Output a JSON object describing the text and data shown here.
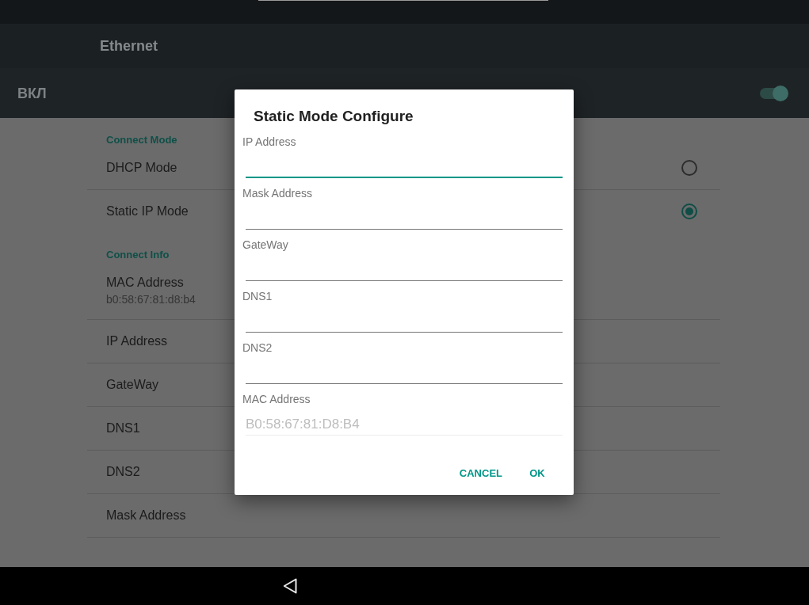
{
  "action_bar": {
    "title": "Ethernet"
  },
  "master_switch": {
    "label": "ВКЛ",
    "on": true
  },
  "settings": {
    "sections": [
      {
        "header": "Connect Mode",
        "items": [
          {
            "kind": "radio",
            "title": "DHCP Mode",
            "selected": false
          },
          {
            "kind": "radio",
            "title": "Static IP Mode",
            "selected": true
          }
        ]
      },
      {
        "header": "Connect Info",
        "items": [
          {
            "kind": "info",
            "title": "MAC Address",
            "summary": "b0:58:67:81:d8:b4"
          },
          {
            "kind": "info",
            "title": "IP Address"
          },
          {
            "kind": "info",
            "title": "GateWay"
          },
          {
            "kind": "info",
            "title": "DNS1"
          },
          {
            "kind": "info",
            "title": "DNS2"
          },
          {
            "kind": "info",
            "title": "Mask Address"
          }
        ]
      }
    ]
  },
  "dialog": {
    "title": "Static Mode Configure",
    "fields": [
      {
        "label": "IP Address",
        "focused": true,
        "disabled": false
      },
      {
        "label": "Mask Address",
        "focused": false,
        "disabled": false
      },
      {
        "label": "GateWay",
        "focused": false,
        "disabled": false
      },
      {
        "label": "DNS1",
        "focused": false,
        "disabled": false
      },
      {
        "label": "DNS2",
        "focused": false,
        "disabled": false
      },
      {
        "label": "MAC Address",
        "value": "B0:58:67:81:D8:B4",
        "focused": false,
        "disabled": true
      }
    ],
    "buttons": [
      {
        "label": "CANCEL"
      },
      {
        "label": "OK"
      }
    ]
  }
}
